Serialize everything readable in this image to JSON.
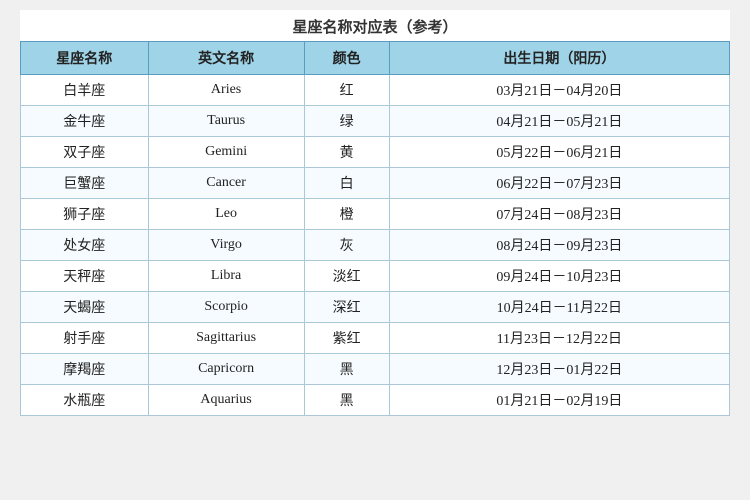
{
  "title": "星座名称对应表（参考）",
  "headers": {
    "name": "星座名称",
    "en_name": "英文名称",
    "color": "颜色",
    "date": "出生日期（阳历）"
  },
  "rows": [
    {
      "name": "白羊座",
      "en": "Aries",
      "color": "红",
      "date": "03月21日－04月20日"
    },
    {
      "name": "金牛座",
      "en": "Taurus",
      "color": "绿",
      "date": "04月21日－05月21日"
    },
    {
      "name": "双子座",
      "en": "Gemini",
      "color": "黄",
      "date": "05月22日－06月21日"
    },
    {
      "name": "巨蟹座",
      "en": "Cancer",
      "color": "白",
      "date": "06月22日－07月23日"
    },
    {
      "name": "狮子座",
      "en": "Leo",
      "color": "橙",
      "date": "07月24日－08月23日"
    },
    {
      "name": "处女座",
      "en": "Virgo",
      "color": "灰",
      "date": "08月24日－09月23日"
    },
    {
      "name": "天秤座",
      "en": "Libra",
      "color": "淡红",
      "date": "09月24日－10月23日"
    },
    {
      "name": "天蝎座",
      "en": "Scorpio",
      "color": "深红",
      "date": "10月24日－11月22日"
    },
    {
      "name": "射手座",
      "en": "Sagittarius",
      "color": "紫红",
      "date": "11月23日－12月22日"
    },
    {
      "name": "摩羯座",
      "en": "Capricorn",
      "color": "黑",
      "date": "12月23日－01月22日"
    },
    {
      "name": "水瓶座",
      "en": "Aquarius",
      "color": "黑",
      "date": "01月21日－02月19日"
    }
  ]
}
